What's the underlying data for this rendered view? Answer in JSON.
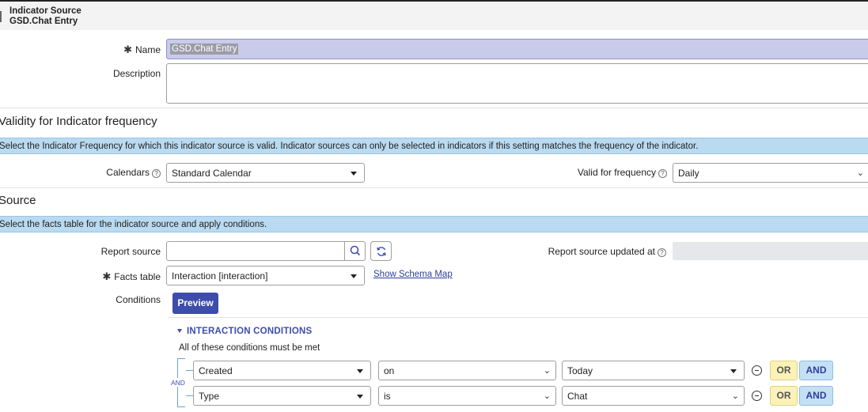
{
  "header": {
    "title": "Indicator Source",
    "subtitle": "GSD.Chat Entry"
  },
  "form": {
    "name": {
      "label": "Name",
      "value": "GSD.Chat Entry"
    },
    "description": {
      "label": "Description",
      "value": ""
    }
  },
  "validity": {
    "title": "Validity for Indicator frequency",
    "banner": "Select the Indicator Frequency for which this indicator source is valid. Indicator sources can only be selected in indicators if this setting matches the frequency of the indicator.",
    "calendars_label": "Calendars",
    "calendars_value": "Standard Calendar",
    "frequency_label": "Valid for frequency",
    "frequency_value": "Daily"
  },
  "source": {
    "title": "Source",
    "banner": "Select the facts table for the indicator source and apply conditions.",
    "report_source_label": "Report source",
    "report_source_value": "",
    "report_updated_label": "Report source updated at",
    "report_updated_value": "",
    "facts_table_label": "Facts table",
    "facts_table_value": "Interaction [interaction]",
    "schema_link": "Show Schema Map",
    "conditions_label": "Conditions",
    "preview_button": "Preview"
  },
  "conditions": {
    "title": "INTERACTION CONDITIONS",
    "subtitle": "All of these conditions must be met",
    "join_label": "AND",
    "rows": [
      {
        "field": "Created",
        "operator": "on",
        "value": "Today",
        "or": "OR",
        "and": "AND"
      },
      {
        "field": "Type",
        "operator": "is",
        "value": "Chat",
        "or": "OR",
        "and": "AND"
      }
    ]
  },
  "colors": {
    "accent": "#3e4cac",
    "banner": "#b9daf0",
    "name_field": "#c9cbea"
  }
}
